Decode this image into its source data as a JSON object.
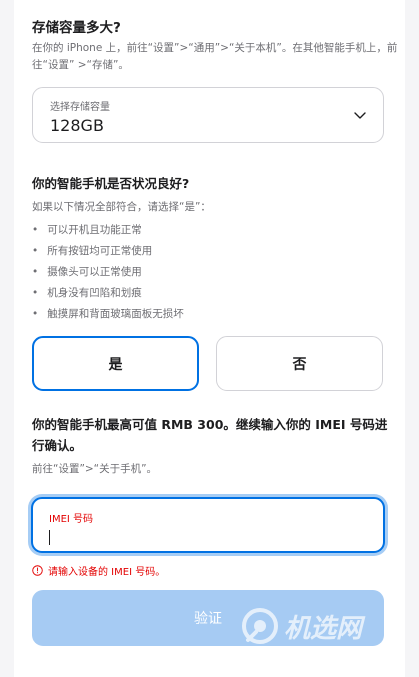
{
  "storage": {
    "title": "存储容量多大?",
    "description": "在你的 iPhone 上，前往“设置”>“通用”>“关于本机”。在其他智能手机上，前往“设置” >“存储”。",
    "select_label": "选择存储容量",
    "select_value": "128GB"
  },
  "condition": {
    "title": "你的智能手机是否状况良好?",
    "intro": "如果以下情况全部符合，请选择“是”：",
    "items": [
      "可以开机且功能正常",
      "所有按钮均可正常使用",
      "摄像头可以正常使用",
      "机身没有凹陷和划痕",
      "触摸屏和背面玻璃面板无损坏"
    ],
    "yes_label": "是",
    "no_label": "否",
    "selected": "yes"
  },
  "imei": {
    "offer": "你的智能手机最高可值 RMB 300。继续输入你的 IMEI 号码进行确认。",
    "hint": "前往“设置”>“关于手机”。",
    "field_label": "IMEI 号码",
    "field_value": "",
    "error": "请输入设备的 IMEI 号码。",
    "submit_label": "验证"
  },
  "watermark": {
    "text": "机选网"
  },
  "colors": {
    "accent": "#0071e3",
    "error": "#e30000",
    "disabled_button": "#a6cbf3"
  }
}
